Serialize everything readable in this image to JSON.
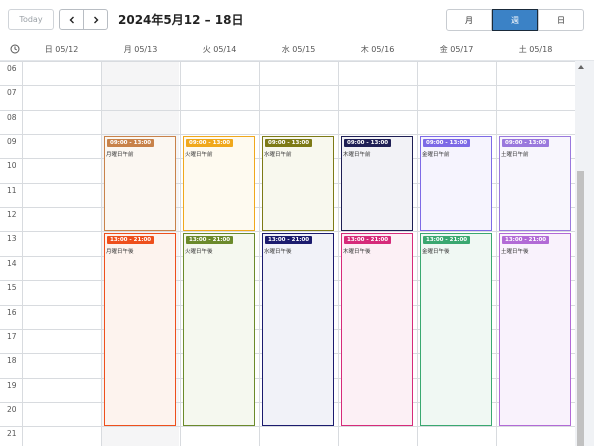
{
  "toolbar": {
    "today_label": "Today",
    "prev_icon": "chevron-left-icon",
    "next_icon": "chevron-right-icon",
    "title": "2024年5月12 – 18日",
    "views": [
      "月",
      "週",
      "日"
    ],
    "active_view": "週"
  },
  "day_headers": [
    "日 05/12",
    "月 05/13",
    "火 05/14",
    "水 05/15",
    "木 05/16",
    "金 05/17",
    "土 05/18"
  ],
  "hours": [
    "06",
    "07",
    "08",
    "09",
    "10",
    "11",
    "12",
    "13",
    "14",
    "15",
    "16",
    "17",
    "18",
    "19",
    "20",
    "21"
  ],
  "events": [
    {
      "day": 1,
      "time": "09:00 - 13:00",
      "label": "月曜日午前",
      "start": 9,
      "end": 13,
      "color": "#c8824a",
      "bg": "#fbf7f2"
    },
    {
      "day": 2,
      "time": "09:00 - 13:00",
      "label": "火曜日午前",
      "start": 9,
      "end": 13,
      "color": "#f0a81c",
      "bg": "#fefaf0"
    },
    {
      "day": 3,
      "time": "09:00 - 13:00",
      "label": "水曜日午前",
      "start": 9,
      "end": 13,
      "color": "#7d7a16",
      "bg": "#f8f8ee"
    },
    {
      "day": 4,
      "time": "09:00 - 13:00",
      "label": "木曜日午前",
      "start": 9,
      "end": 13,
      "color": "#1f1f55",
      "bg": "#f2f2f6"
    },
    {
      "day": 5,
      "time": "09:00 - 13:00",
      "label": "金曜日午前",
      "start": 9,
      "end": 13,
      "color": "#7d6ae6",
      "bg": "#f6f4fe"
    },
    {
      "day": 6,
      "time": "09:00 - 13:00",
      "label": "土曜日午前",
      "start": 9,
      "end": 13,
      "color": "#9a79dd",
      "bg": "#f8f6fd"
    },
    {
      "day": 1,
      "time": "13:00 - 21:00",
      "label": "月曜日午後",
      "start": 13,
      "end": 21,
      "color": "#ee4f1c",
      "bg": "#fdf3ee"
    },
    {
      "day": 2,
      "time": "13:00 - 21:00",
      "label": "火曜日午後",
      "start": 13,
      "end": 21,
      "color": "#6b8a2b",
      "bg": "#f5f8ef"
    },
    {
      "day": 3,
      "time": "13:00 - 21:00",
      "label": "水曜日午後",
      "start": 13,
      "end": 21,
      "color": "#1b1b6e",
      "bg": "#f1f2f8"
    },
    {
      "day": 4,
      "time": "13:00 - 21:00",
      "label": "木曜日午後",
      "start": 13,
      "end": 21,
      "color": "#d62b7a",
      "bg": "#fcf0f5"
    },
    {
      "day": 5,
      "time": "13:00 - 21:00",
      "label": "金曜日午後",
      "start": 13,
      "end": 21,
      "color": "#3aa870",
      "bg": "#f0f8f3"
    },
    {
      "day": 6,
      "time": "13:00 - 21:00",
      "label": "土曜日午後",
      "start": 13,
      "end": 21,
      "color": "#b26ad6",
      "bg": "#f9f2fc"
    }
  ]
}
